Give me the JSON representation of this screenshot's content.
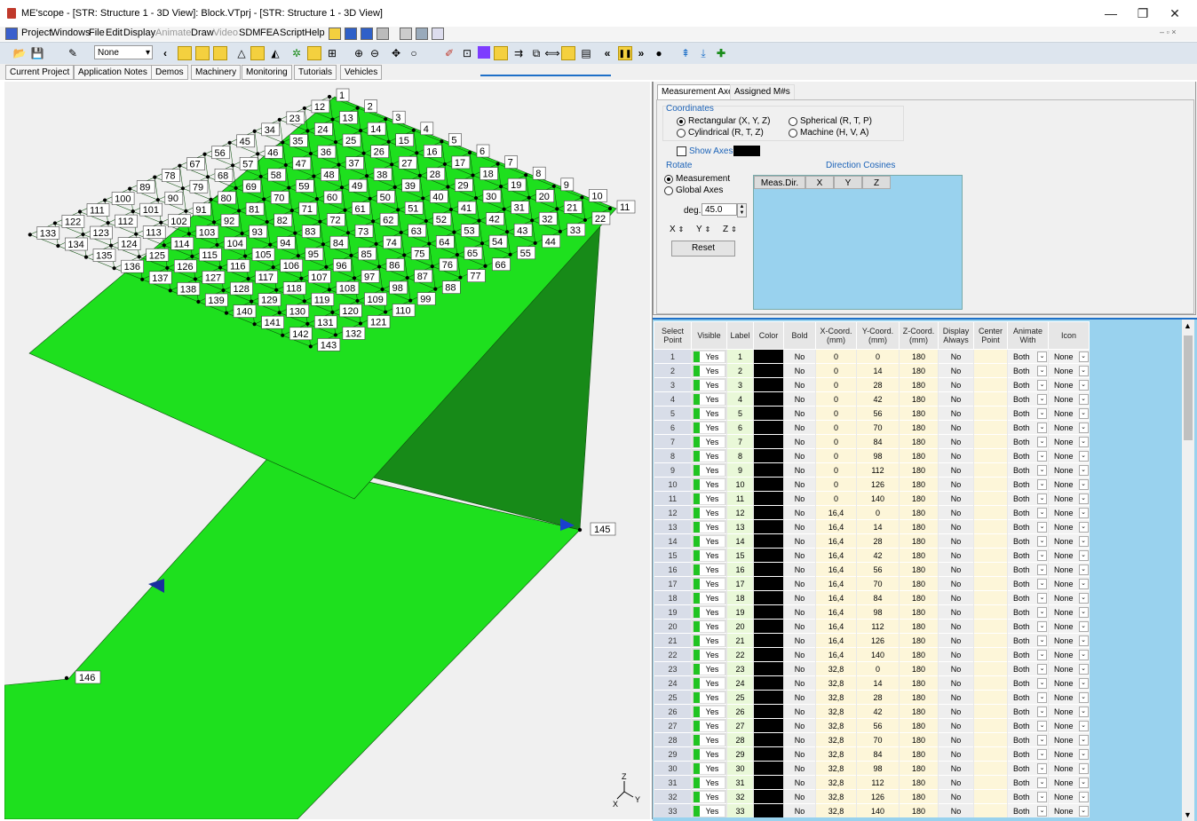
{
  "window": {
    "title": "ME'scope - [STR: Structure 1 - 3D View]: Block.VTprj - [STR: Structure 1 - 3D View]",
    "minimize": "—",
    "restore": "❐",
    "close": "✕"
  },
  "menu": [
    {
      "label": "Project",
      "disabled": false
    },
    {
      "label": "Windows",
      "disabled": false
    },
    {
      "label": "File",
      "disabled": false
    },
    {
      "label": "Edit",
      "disabled": false
    },
    {
      "label": "Display",
      "disabled": false
    },
    {
      "label": "Animate",
      "disabled": true
    },
    {
      "label": "Draw",
      "disabled": false
    },
    {
      "label": "Video",
      "disabled": true
    },
    {
      "label": "SDM",
      "disabled": false
    },
    {
      "label": "FEA",
      "disabled": false
    },
    {
      "label": "Script",
      "disabled": false
    },
    {
      "label": "Help",
      "disabled": false
    }
  ],
  "toolbar": {
    "select_value": "None",
    "select_arrow": "▾",
    "back_arrow": "‹",
    "rewind": "«",
    "pause": "❚❚",
    "forward": "»"
  },
  "quick_tabs": [
    "Current Project",
    "Application Notes",
    "Demos",
    "Machinery",
    "Monitoring",
    "Tutorials",
    "Vehicles"
  ],
  "view3d": {
    "point_labels_top": [
      "1",
      "2",
      "3",
      "4",
      "5",
      "6",
      "7",
      "8",
      "9",
      "10",
      "11",
      "12",
      "13",
      "14",
      "15",
      "16",
      "17",
      "18",
      "19",
      "20",
      "21",
      "22",
      "23",
      "24",
      "25",
      "26",
      "27",
      "28",
      "29",
      "30",
      "31",
      "32",
      "33",
      "34",
      "35",
      "36",
      "37",
      "38",
      "39",
      "40",
      "41",
      "42",
      "43",
      "44",
      "45",
      "46",
      "47",
      "48",
      "49",
      "50",
      "51",
      "52",
      "53",
      "54",
      "55",
      "56",
      "57",
      "58",
      "59",
      "60",
      "61",
      "62",
      "63",
      "64",
      "65",
      "66",
      "67",
      "68",
      "69",
      "70",
      "71",
      "72",
      "73",
      "74",
      "75",
      "76",
      "77",
      "78",
      "79",
      "80",
      "81",
      "82",
      "83",
      "84",
      "85",
      "86",
      "87",
      "88",
      "89",
      "90",
      "91",
      "92",
      "93",
      "94",
      "95",
      "96",
      "97",
      "98",
      "99",
      "100",
      "101",
      "102",
      "103",
      "104",
      "105",
      "106",
      "107",
      "108",
      "109",
      "110",
      "111",
      "112",
      "113",
      "114",
      "115",
      "116",
      "117",
      "118",
      "119",
      "120",
      "121",
      "122",
      "123",
      "124",
      "125",
      "126",
      "127",
      "128",
      "129",
      "130",
      "131",
      "132",
      "133",
      "134",
      "135",
      "136",
      "137",
      "138",
      "139",
      "140",
      "141",
      "142",
      "143"
    ],
    "point_145": "145",
    "point_146": "146",
    "axis_triad": {
      "z": "Z",
      "x": "X",
      "y": "Y"
    }
  },
  "props": {
    "tabs": [
      {
        "label": "Measurement Axes",
        "active": true
      },
      {
        "label": "Assigned M#s",
        "active": false
      }
    ],
    "coordinates_title": "Coordinates",
    "coord_options": [
      {
        "label": "Rectangular (X, Y, Z)",
        "checked": true
      },
      {
        "label": "Cylindrical (R, T, Z)",
        "checked": false
      },
      {
        "label": "Spherical (R, T, P)",
        "checked": false
      },
      {
        "label": "Machine (H, V, A)",
        "checked": false
      }
    ],
    "show_axes": "Show Axes",
    "rotate_title": "Rotate",
    "rotate_options": [
      {
        "label": "Measurement",
        "checked": true
      },
      {
        "label": "Global Axes",
        "checked": false
      }
    ],
    "deg_label": "deg.",
    "deg_value": "45.0",
    "axis_buttons": [
      "X",
      "Y",
      "Z"
    ],
    "reset": "Reset",
    "direction_cosines_title": "Direction Cosines",
    "dc_columns": [
      "Meas.Dir.",
      "X",
      "Y",
      "Z"
    ]
  },
  "grid": {
    "headers": {
      "select": "Select Point",
      "visible": "Visible",
      "label": "Label",
      "color": "Color",
      "bold": "Bold",
      "x": "X-Coord. (mm)",
      "y": "Y-Coord. (mm)",
      "z": "Z-Coord. (mm)",
      "display": "Display Always",
      "center": "Center Point",
      "animate": "Animate With",
      "icon": "Icon"
    },
    "rows": [
      {
        "n": "1",
        "vis": "Yes",
        "label": "1",
        "bold": "No",
        "x": "0",
        "y": "0",
        "z": "180",
        "disp": "No",
        "anim": "Both",
        "icon": "None"
      },
      {
        "n": "2",
        "vis": "Yes",
        "label": "2",
        "bold": "No",
        "x": "0",
        "y": "14",
        "z": "180",
        "disp": "No",
        "anim": "Both",
        "icon": "None"
      },
      {
        "n": "3",
        "vis": "Yes",
        "label": "3",
        "bold": "No",
        "x": "0",
        "y": "28",
        "z": "180",
        "disp": "No",
        "anim": "Both",
        "icon": "None"
      },
      {
        "n": "4",
        "vis": "Yes",
        "label": "4",
        "bold": "No",
        "x": "0",
        "y": "42",
        "z": "180",
        "disp": "No",
        "anim": "Both",
        "icon": "None"
      },
      {
        "n": "5",
        "vis": "Yes",
        "label": "5",
        "bold": "No",
        "x": "0",
        "y": "56",
        "z": "180",
        "disp": "No",
        "anim": "Both",
        "icon": "None"
      },
      {
        "n": "6",
        "vis": "Yes",
        "label": "6",
        "bold": "No",
        "x": "0",
        "y": "70",
        "z": "180",
        "disp": "No",
        "anim": "Both",
        "icon": "None"
      },
      {
        "n": "7",
        "vis": "Yes",
        "label": "7",
        "bold": "No",
        "x": "0",
        "y": "84",
        "z": "180",
        "disp": "No",
        "anim": "Both",
        "icon": "None"
      },
      {
        "n": "8",
        "vis": "Yes",
        "label": "8",
        "bold": "No",
        "x": "0",
        "y": "98",
        "z": "180",
        "disp": "No",
        "anim": "Both",
        "icon": "None"
      },
      {
        "n": "9",
        "vis": "Yes",
        "label": "9",
        "bold": "No",
        "x": "0",
        "y": "112",
        "z": "180",
        "disp": "No",
        "anim": "Both",
        "icon": "None"
      },
      {
        "n": "10",
        "vis": "Yes",
        "label": "10",
        "bold": "No",
        "x": "0",
        "y": "126",
        "z": "180",
        "disp": "No",
        "anim": "Both",
        "icon": "None"
      },
      {
        "n": "11",
        "vis": "Yes",
        "label": "11",
        "bold": "No",
        "x": "0",
        "y": "140",
        "z": "180",
        "disp": "No",
        "anim": "Both",
        "icon": "None"
      },
      {
        "n": "12",
        "vis": "Yes",
        "label": "12",
        "bold": "No",
        "x": "16,4",
        "y": "0",
        "z": "180",
        "disp": "No",
        "anim": "Both",
        "icon": "None"
      },
      {
        "n": "13",
        "vis": "Yes",
        "label": "13",
        "bold": "No",
        "x": "16,4",
        "y": "14",
        "z": "180",
        "disp": "No",
        "anim": "Both",
        "icon": "None"
      },
      {
        "n": "14",
        "vis": "Yes",
        "label": "14",
        "bold": "No",
        "x": "16,4",
        "y": "28",
        "z": "180",
        "disp": "No",
        "anim": "Both",
        "icon": "None"
      },
      {
        "n": "15",
        "vis": "Yes",
        "label": "15",
        "bold": "No",
        "x": "16,4",
        "y": "42",
        "z": "180",
        "disp": "No",
        "anim": "Both",
        "icon": "None"
      },
      {
        "n": "16",
        "vis": "Yes",
        "label": "16",
        "bold": "No",
        "x": "16,4",
        "y": "56",
        "z": "180",
        "disp": "No",
        "anim": "Both",
        "icon": "None"
      },
      {
        "n": "17",
        "vis": "Yes",
        "label": "17",
        "bold": "No",
        "x": "16,4",
        "y": "70",
        "z": "180",
        "disp": "No",
        "anim": "Both",
        "icon": "None"
      },
      {
        "n": "18",
        "vis": "Yes",
        "label": "18",
        "bold": "No",
        "x": "16,4",
        "y": "84",
        "z": "180",
        "disp": "No",
        "anim": "Both",
        "icon": "None"
      },
      {
        "n": "19",
        "vis": "Yes",
        "label": "19",
        "bold": "No",
        "x": "16,4",
        "y": "98",
        "z": "180",
        "disp": "No",
        "anim": "Both",
        "icon": "None"
      },
      {
        "n": "20",
        "vis": "Yes",
        "label": "20",
        "bold": "No",
        "x": "16,4",
        "y": "112",
        "z": "180",
        "disp": "No",
        "anim": "Both",
        "icon": "None"
      },
      {
        "n": "21",
        "vis": "Yes",
        "label": "21",
        "bold": "No",
        "x": "16,4",
        "y": "126",
        "z": "180",
        "disp": "No",
        "anim": "Both",
        "icon": "None"
      },
      {
        "n": "22",
        "vis": "Yes",
        "label": "22",
        "bold": "No",
        "x": "16,4",
        "y": "140",
        "z": "180",
        "disp": "No",
        "anim": "Both",
        "icon": "None"
      },
      {
        "n": "23",
        "vis": "Yes",
        "label": "23",
        "bold": "No",
        "x": "32,8",
        "y": "0",
        "z": "180",
        "disp": "No",
        "anim": "Both",
        "icon": "None"
      },
      {
        "n": "24",
        "vis": "Yes",
        "label": "24",
        "bold": "No",
        "x": "32,8",
        "y": "14",
        "z": "180",
        "disp": "No",
        "anim": "Both",
        "icon": "None"
      },
      {
        "n": "25",
        "vis": "Yes",
        "label": "25",
        "bold": "No",
        "x": "32,8",
        "y": "28",
        "z": "180",
        "disp": "No",
        "anim": "Both",
        "icon": "None"
      },
      {
        "n": "26",
        "vis": "Yes",
        "label": "26",
        "bold": "No",
        "x": "32,8",
        "y": "42",
        "z": "180",
        "disp": "No",
        "anim": "Both",
        "icon": "None"
      },
      {
        "n": "27",
        "vis": "Yes",
        "label": "27",
        "bold": "No",
        "x": "32,8",
        "y": "56",
        "z": "180",
        "disp": "No",
        "anim": "Both",
        "icon": "None"
      },
      {
        "n": "28",
        "vis": "Yes",
        "label": "28",
        "bold": "No",
        "x": "32,8",
        "y": "70",
        "z": "180",
        "disp": "No",
        "anim": "Both",
        "icon": "None"
      },
      {
        "n": "29",
        "vis": "Yes",
        "label": "29",
        "bold": "No",
        "x": "32,8",
        "y": "84",
        "z": "180",
        "disp": "No",
        "anim": "Both",
        "icon": "None"
      },
      {
        "n": "30",
        "vis": "Yes",
        "label": "30",
        "bold": "No",
        "x": "32,8",
        "y": "98",
        "z": "180",
        "disp": "No",
        "anim": "Both",
        "icon": "None"
      },
      {
        "n": "31",
        "vis": "Yes",
        "label": "31",
        "bold": "No",
        "x": "32,8",
        "y": "112",
        "z": "180",
        "disp": "No",
        "anim": "Both",
        "icon": "None"
      },
      {
        "n": "32",
        "vis": "Yes",
        "label": "32",
        "bold": "No",
        "x": "32,8",
        "y": "126",
        "z": "180",
        "disp": "No",
        "anim": "Both",
        "icon": "None"
      },
      {
        "n": "33",
        "vis": "Yes",
        "label": "33",
        "bold": "No",
        "x": "32,8",
        "y": "140",
        "z": "180",
        "disp": "No",
        "anim": "Both",
        "icon": "None"
      }
    ]
  },
  "colors": {
    "mesh_green": "#1ee01e",
    "mesh_dark_green": "#0f7a10",
    "face_side_green": "#178a18",
    "blue_panel": "#99d2ee",
    "accent_blue": "#1e70c8"
  }
}
